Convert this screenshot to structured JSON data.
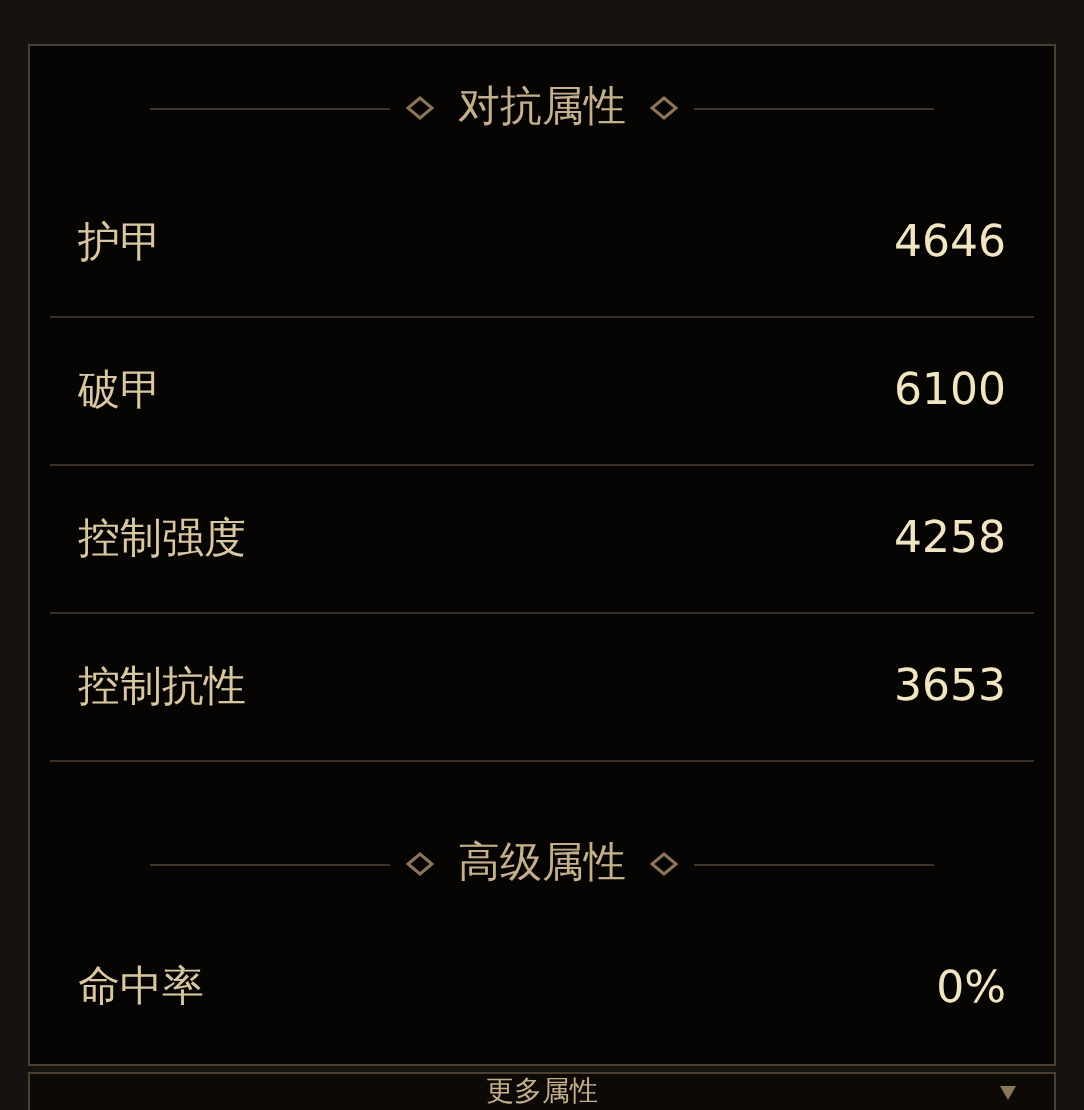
{
  "sections": [
    {
      "title": "对抗属性",
      "rows": [
        {
          "label": "护甲",
          "value": "4646"
        },
        {
          "label": "破甲",
          "value": "6100"
        },
        {
          "label": "控制强度",
          "value": "4258"
        },
        {
          "label": "控制抗性",
          "value": "3653"
        }
      ]
    },
    {
      "title": "高级属性",
      "rows": [
        {
          "label": "命中率",
          "value": "0%"
        }
      ]
    }
  ],
  "footer": {
    "label": "更多属性"
  }
}
